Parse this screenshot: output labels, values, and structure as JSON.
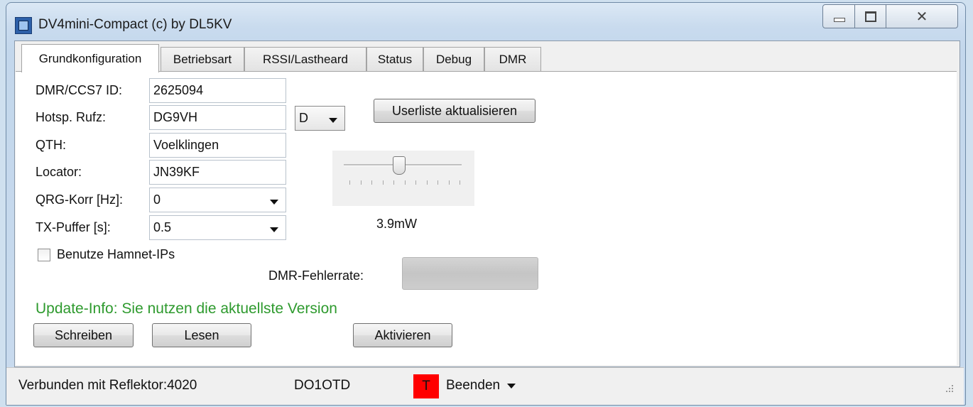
{
  "window": {
    "title": "DV4mini-Compact (c) by DL5KV"
  },
  "tabs": [
    {
      "label": "Grundkonfiguration"
    },
    {
      "label": "Betriebsart"
    },
    {
      "label": "RSSI/Lastheard"
    },
    {
      "label": "Status"
    },
    {
      "label": "Debug"
    },
    {
      "label": "DMR"
    }
  ],
  "form": {
    "dmr_id_label": "DMR/CCS7 ID:",
    "dmr_id_value": "2625094",
    "callsign_label": "Hotsp. Rufz:",
    "callsign_value": "DG9VH",
    "callsign_suffix": "D",
    "qth_label": "QTH:",
    "qth_value": "Voelklingen",
    "locator_label": "Locator:",
    "locator_value": "JN39KF",
    "qrg_label": "QRG-Korr [Hz]:",
    "qrg_value": "0",
    "txbuf_label": "TX-Puffer [s]:",
    "txbuf_value": "0.5",
    "hamnet_label": "Benutze Hamnet-IPs",
    "hamnet_checked": false
  },
  "buttons": {
    "update_userlist": "Userliste aktualisieren",
    "write": "Schreiben",
    "read": "Lesen",
    "activate": "Aktivieren"
  },
  "power": {
    "label": "3.9mW",
    "slider_fraction": 0.47
  },
  "error_rate": {
    "label": "DMR-Fehlerrate:"
  },
  "update_info": {
    "text": "Update-Info: Sie nutzen die aktuellste Version",
    "color": "#2e9a2e"
  },
  "statusbar": {
    "connection": "Verbunden mit Reflektor:4020",
    "callsign": "DO1OTD",
    "tx_indicator": "T",
    "tx_color": "#ff0000",
    "quit_label": "Beenden"
  }
}
